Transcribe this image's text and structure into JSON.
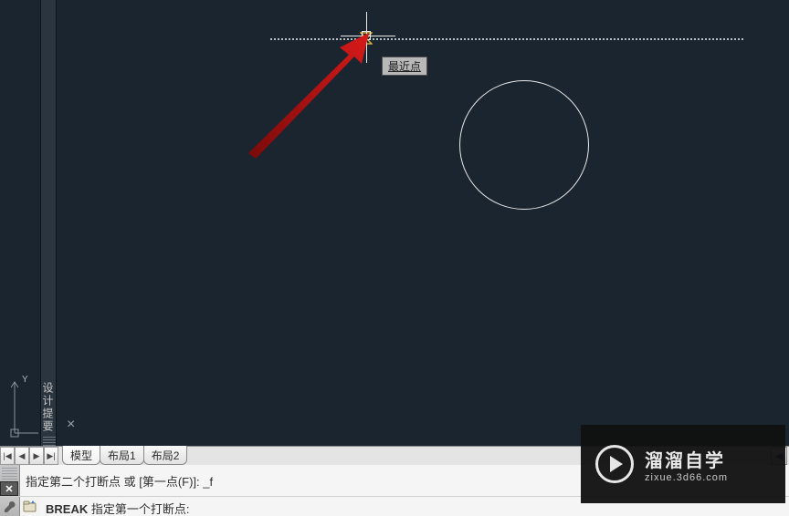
{
  "canvas": {
    "osnap_tooltip": "最近点",
    "ucs_label": "Y",
    "design_summary_label": "设计提要",
    "x_mark": "×"
  },
  "tabs": {
    "nav_first": "|◀",
    "nav_prev": "◀",
    "nav_next": "▶",
    "nav_last": "▶|",
    "model": "模型",
    "layout1": "布局1",
    "layout2": "布局2",
    "scroll_right": "◀"
  },
  "command": {
    "history_line": "指定第二个打断点 或 [第一点(F)]: _f",
    "prompt_command": "BREAK",
    "prompt_rest": " 指定第一个打断点: "
  },
  "watermark": {
    "title": "溜溜自学",
    "url": "zixue.3d66.com"
  },
  "icons": {
    "close": "✕",
    "wrench": "🔧"
  }
}
